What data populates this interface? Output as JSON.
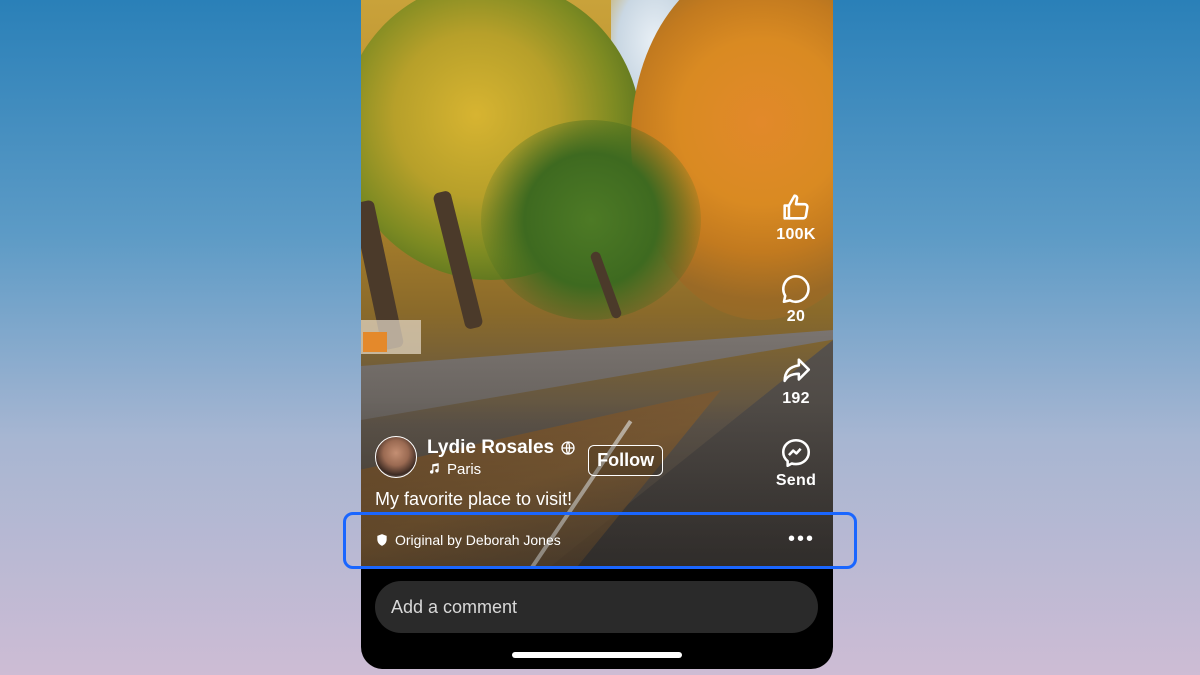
{
  "post": {
    "author_name": "Lydie Rosales",
    "audio_label": "Paris",
    "follow_label": "Follow",
    "caption": "My favorite place to visit!",
    "original_label": "Original by Deborah Jones",
    "more_label": "•••"
  },
  "actions": {
    "like_count": "100K",
    "comment_count": "20",
    "share_count": "192",
    "send_label": "Send"
  },
  "comment_box": {
    "placeholder": "Add a comment"
  },
  "colors": {
    "highlight": "#1a66ff",
    "comment_bg": "#2a2a2a"
  }
}
